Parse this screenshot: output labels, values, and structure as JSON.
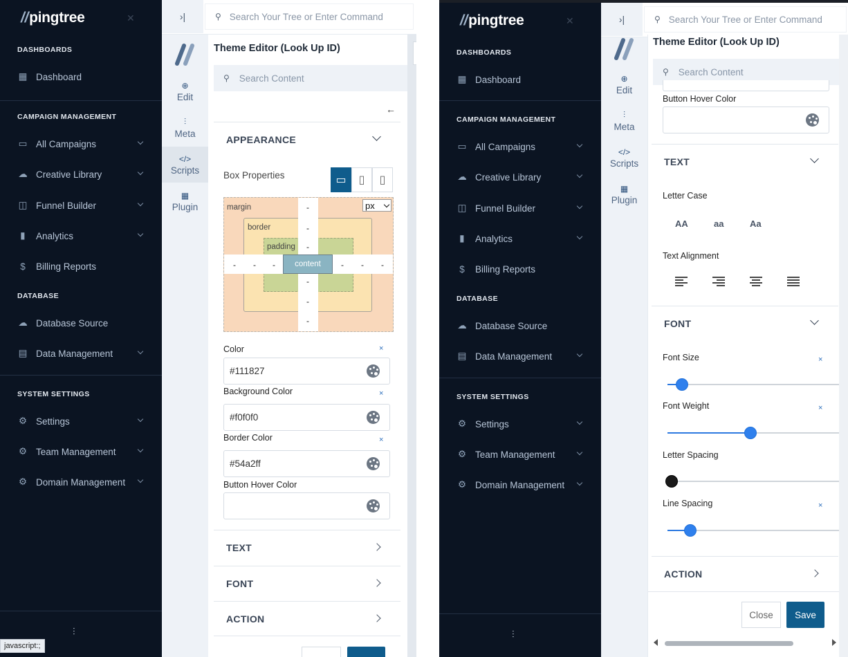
{
  "app": {
    "logo": "pingtree",
    "logo_slash": "//"
  },
  "topbar": {
    "search_placeholder": "Search Your Tree or Enter Command"
  },
  "sidebar": {
    "sections": {
      "dashboards": "DASHBOARDS",
      "campaign": "CAMPAIGN MANAGEMENT",
      "database": "DATABASE",
      "system": "SYSTEM SETTINGS"
    },
    "items": {
      "dashboard": "Dashboard",
      "all_campaigns": "All Campaigns",
      "creative_library": "Creative Library",
      "funnel_builder": "Funnel Builder",
      "analytics": "Analytics",
      "billing_reports": "Billing Reports",
      "database_source": "Database Source",
      "data_management": "Data Management",
      "settings": "Settings",
      "team_management": "Team Management",
      "domain_management": "Domain Management"
    }
  },
  "status_tooltip": "javascript:;",
  "rail": {
    "edit": "Edit",
    "meta": "Meta",
    "scripts": "Scripts",
    "plugin": "Plugin"
  },
  "editor": {
    "title": "Theme Editor  (Look Up ID)",
    "search_placeholder": "Search Content",
    "appearance": {
      "heading": "APPEARANCE",
      "box_properties": "Box Properties",
      "boxmodel": {
        "margin": "margin",
        "border": "border",
        "padding": "padding",
        "content": "content",
        "unit": "px",
        "dash": "-"
      },
      "color_label": "Color",
      "color_value": "#111827",
      "bg_label": "Background Color",
      "bg_value": "#f0f0f0",
      "border_label": "Border Color",
      "border_value": "#54a2ff",
      "hover_label": "Button Hover Color",
      "hover_value": "",
      "clear": "×"
    },
    "text": {
      "heading": "TEXT",
      "letter_case": "Letter Case",
      "case_upper": "AA",
      "case_lower": "aa",
      "case_title": "Aa",
      "alignment": "Text Alignment"
    },
    "font": {
      "heading": "FONT",
      "size_label": "Font Size",
      "size_pos": 0.06,
      "weight_label": "Font Weight",
      "weight_pos": 0.46,
      "letter_label": "Letter Spacing",
      "letter_pos": 0.0,
      "line_label": "Line Spacing",
      "line_pos": 0.11
    },
    "action": {
      "heading": "ACTION"
    },
    "buttons": {
      "close": "Close",
      "save": "Save"
    }
  },
  "colors": {
    "sidebar_bg": "#0b1422",
    "accent": "#0f5c8c",
    "slider": "#2f80ed"
  }
}
